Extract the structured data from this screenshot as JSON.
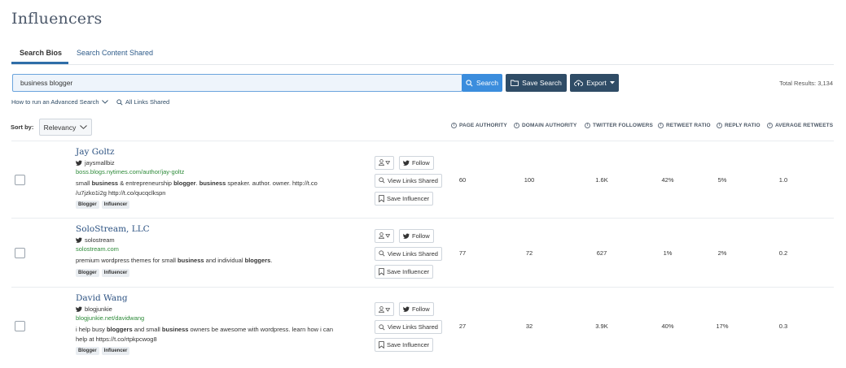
{
  "page": {
    "title": "Influencers"
  },
  "tabs": [
    {
      "label": "Search Bios",
      "active": true
    },
    {
      "label": "Search Content Shared",
      "active": false
    }
  ],
  "search": {
    "value": "business blogger",
    "button_label": "Search"
  },
  "toolbar": {
    "save_search_label": "Save Search",
    "export_label": "Export"
  },
  "results": {
    "total_label": "Total Results: 3,134"
  },
  "links": {
    "advanced_search": "How to run an Advanced Search",
    "all_links": "All Links Shared"
  },
  "sort": {
    "label": "Sort by:",
    "selected": "Relevancy"
  },
  "columns": [
    "PAGE AUTHORITY",
    "DOMAIN AUTHORITY",
    "TWITTER FOLLOWERS",
    "RETWEET RATIO",
    "REPLY RATIO",
    "AVERAGE RETWEETS"
  ],
  "actions": {
    "follow": "Follow",
    "view_links": "View Links Shared",
    "save_influencer": "Save Influencer"
  },
  "influencers": [
    {
      "name": "Jay Goltz",
      "handle": "jaysmallbiz",
      "site": "boss.blogs.nytimes.com/author/jay-goltz",
      "bio_html": "small <b>business</b> &amp; entrepreneurship <b>blogger</b>. <b>business</b> speaker. author. owner. http://t.co<br>/u7jzko1i2g http://t.co/qucqclkspn",
      "tags": [
        "Blogger",
        "Influencer"
      ],
      "page_authority": "60",
      "domain_authority": "100",
      "twitter_followers": "1.6K",
      "retweet_ratio": "42%",
      "reply_ratio": "5%",
      "average_retweets": "1.0"
    },
    {
      "name": "SoloStream, LLC",
      "handle": "solostream",
      "site": "solostream.com",
      "bio_html": "premium wordpress themes for small <b>business</b> and individual <b>bloggers</b>.",
      "tags": [
        "Blogger",
        "Influencer"
      ],
      "page_authority": "77",
      "domain_authority": "72",
      "twitter_followers": "627",
      "retweet_ratio": "1%",
      "reply_ratio": "2%",
      "average_retweets": "0.2"
    },
    {
      "name": "David Wang",
      "handle": "blogjunkie",
      "site": "blogjunkie.net/davidwang",
      "bio_html": "i help busy <b>bloggers</b> and small <b>business</b> owners be awesome with wordpress. learn how i can<br>help at https://t.co/rtpkpcwog8",
      "tags": [
        "Blogger",
        "Influencer"
      ],
      "page_authority": "27",
      "domain_authority": "32",
      "twitter_followers": "3.9K",
      "retweet_ratio": "40%",
      "reply_ratio": "17%",
      "average_retweets": "0.3"
    }
  ],
  "colors": {
    "accent": "#3b8ddd",
    "dark_button": "#2f4c66",
    "link": "#2c5282",
    "site_green": "#2e8b3a"
  }
}
